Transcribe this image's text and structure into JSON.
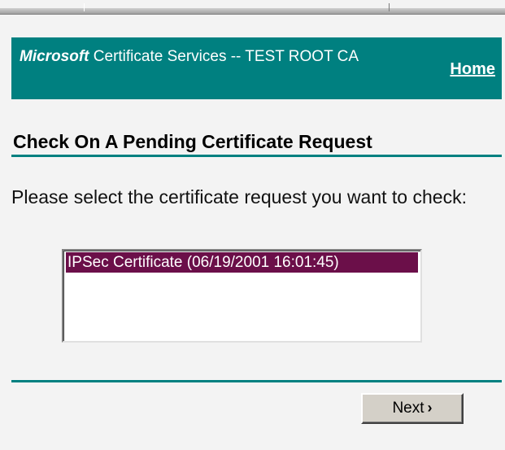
{
  "header": {
    "brand": "Microsoft",
    "title": "Certificate Services  --  TEST ROOT CA",
    "home_link": "Home"
  },
  "page": {
    "title": "Check On A Pending Certificate Request",
    "prompt": "Please select the certificate request you want to check:"
  },
  "request_list": {
    "items": [
      {
        "label": "IPSec Certificate (06/19/2001 16:01:45)",
        "selected": true
      }
    ]
  },
  "actions": {
    "next_label": "Next",
    "next_icon": "chevron-right-icon"
  },
  "colors": {
    "accent_teal": "#008080",
    "selection": "#6b0f49",
    "button_face": "#d4d0c8"
  }
}
